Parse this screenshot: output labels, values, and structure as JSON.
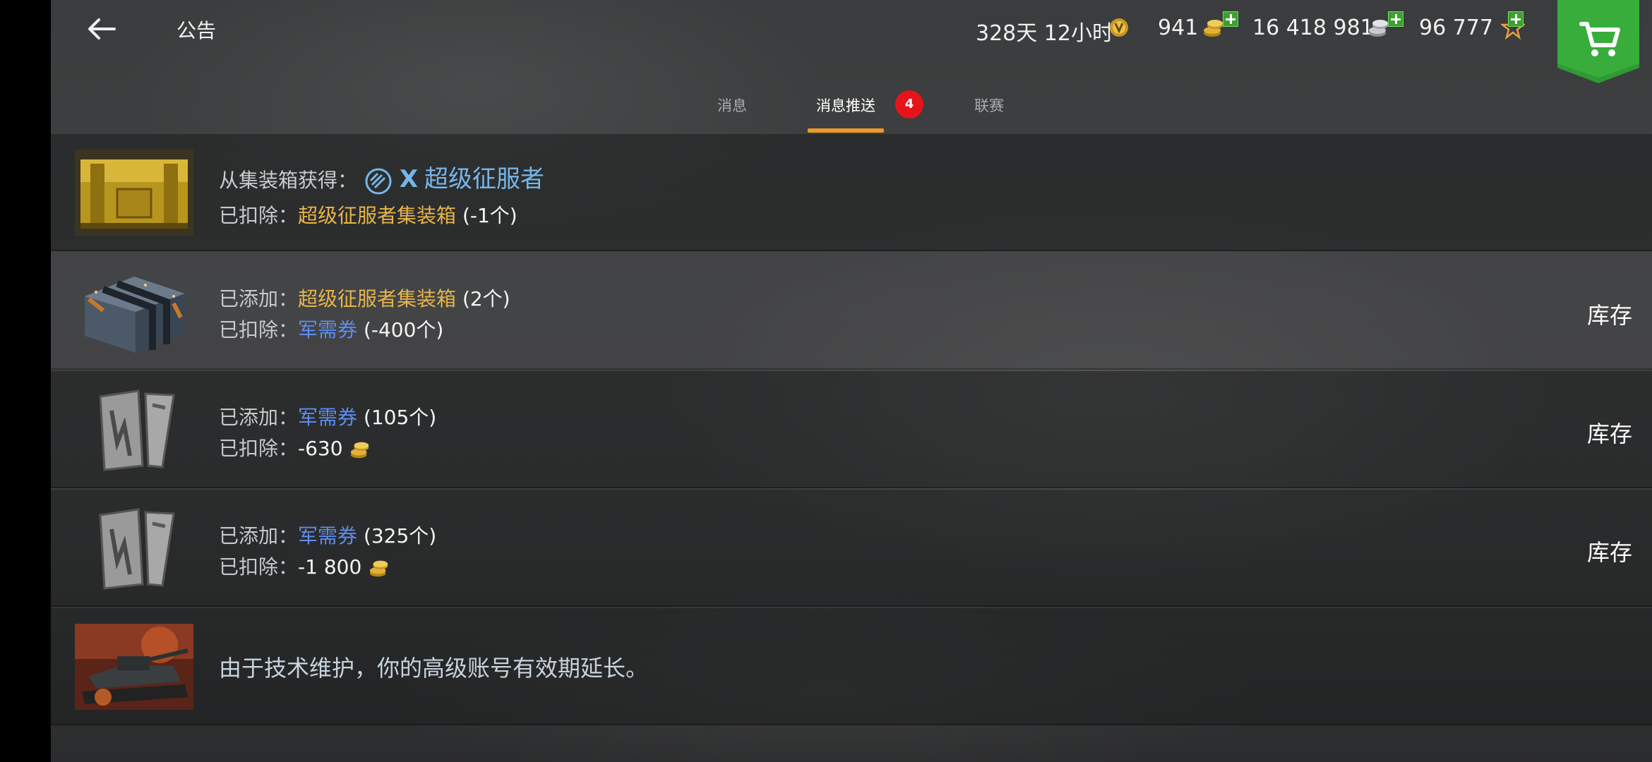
{
  "header": {
    "title": "公告",
    "timer_text": "328天 12小时",
    "gold_value": "941",
    "silver_value": "16 418 981",
    "exp_value": "96 777"
  },
  "tabs": [
    {
      "label": "消息"
    },
    {
      "label": "消息推送",
      "badge": "4"
    },
    {
      "label": "联赛"
    }
  ],
  "notifications": [
    {
      "l1_label": "从集装箱获得：",
      "l1_badge": "X",
      "l1_value": "超级征服者",
      "l2_label": "已扣除：",
      "l2_value": "超级征服者集装箱",
      "l2_amount": "(-1个)"
    },
    {
      "l1_label": "已添加：",
      "l1_value": "超级征服者集装箱",
      "l1_amount": "(2个)",
      "l2_label": "已扣除：",
      "l2_value": "军需券",
      "l2_amount": "(-400个)",
      "action": "库存"
    },
    {
      "l1_label": "已添加：",
      "l1_value": "军需券",
      "l1_amount": "(105个)",
      "l2_label": "已扣除：",
      "l2_amount": "-630",
      "action": "库存"
    },
    {
      "l1_label": "已添加：",
      "l1_value": "军需券",
      "l1_amount": "(325个)",
      "l2_label": "已扣除：",
      "l2_amount": "-1 800",
      "action": "库存"
    },
    {
      "message": "由于技术维护，你的高级账号有效期延长。"
    }
  ],
  "colors": {
    "tab_underline": "#ee9a2a",
    "badge": "#e5141a",
    "item_gold_text": "#e6b44a",
    "item_blue_text": "#5d8df0",
    "shop_green": "#2f9a33"
  },
  "icons": [
    "back-arrow-icon",
    "premium-timer-icon",
    "gold-coins-icon",
    "silver-coins-icon",
    "free-exp-star-icon",
    "shopping-cart-icon"
  ]
}
